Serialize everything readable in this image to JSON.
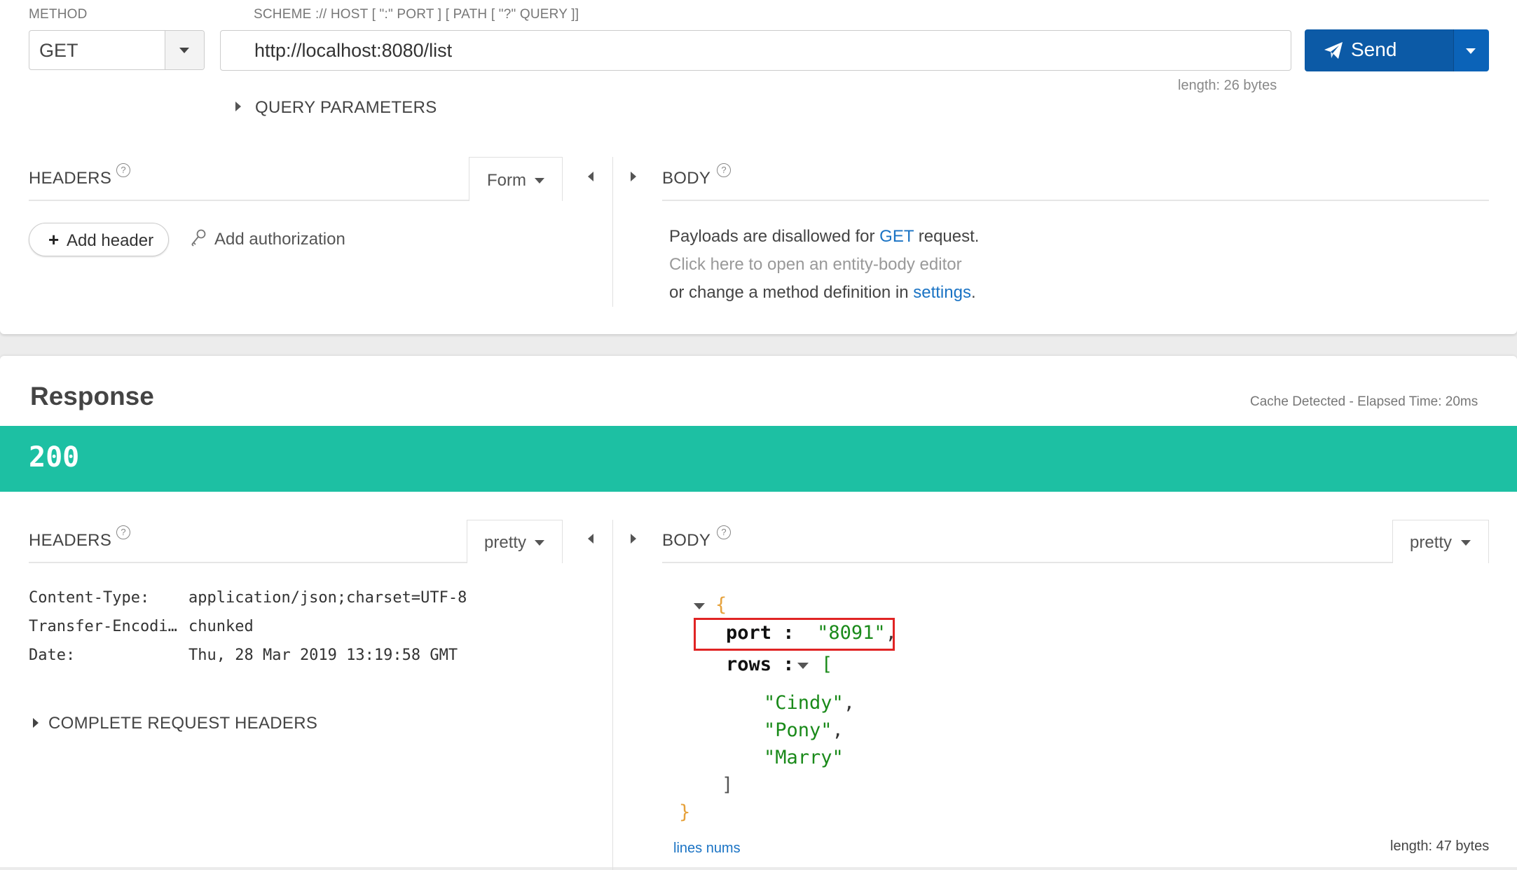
{
  "request": {
    "method_label": "METHOD",
    "method_value": "GET",
    "url_label": "SCHEME :// HOST [ \":\" PORT ] [ PATH [ \"?\" QUERY ]]",
    "url_value": "http://localhost:8080/list",
    "url_length": "length: 26 bytes",
    "send_label": "Send",
    "query_params_label": "QUERY PARAMETERS",
    "headers": {
      "title": "HEADERS",
      "mode": "Form",
      "add_header_label": "Add header",
      "add_authorization_label": "Add authorization"
    },
    "body": {
      "title": "BODY",
      "line1_prefix": "Payloads are disallowed for ",
      "line1_method": "GET",
      "line1_suffix": " request.",
      "line2": "Click here to open an entity-body editor",
      "line3_prefix": "or change a method definition in ",
      "line3_link": "settings",
      "line3_suffix": "."
    }
  },
  "response": {
    "title": "Response",
    "cache_info": "Cache Detected - Elapsed Time: 20ms",
    "status_code": "200",
    "headers": {
      "title": "HEADERS",
      "mode": "pretty",
      "rows": [
        {
          "name": "Content-Type:",
          "value": "application/json;charset=UTF-8"
        },
        {
          "name": "Transfer-Encodi…",
          "value": "chunked"
        },
        {
          "name": "Date:",
          "value": "Thu, 28 Mar 2019 13:19:58 GMT"
        }
      ],
      "complete_label": "COMPLETE REQUEST HEADERS"
    },
    "body": {
      "title": "BODY",
      "mode": "pretty",
      "json": {
        "open_brace": "{",
        "port_key": "port",
        "port_value": "\"8091\"",
        "rows_key": "rows",
        "rows_open": "[",
        "rows_values": [
          "\"Cindy\"",
          "\"Pony\"",
          "\"Marry\""
        ],
        "rows_close": "]",
        "close_brace": "}"
      },
      "lines_nums_label": "lines nums",
      "length": "length: 47 bytes"
    }
  },
  "colors": {
    "accent": "#0c5aa6",
    "status_ok": "#1dc0a3",
    "link": "#1a73c4",
    "highlight": "#e02424"
  }
}
